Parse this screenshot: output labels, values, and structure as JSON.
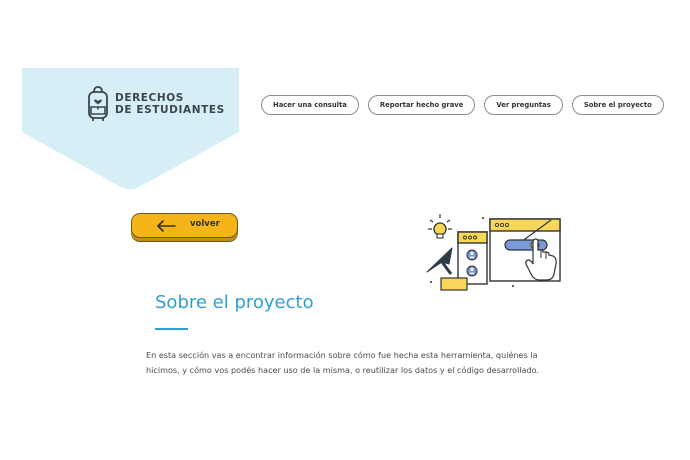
{
  "header": {
    "logo_line1": "DERECHOS",
    "logo_line2": "DE ESTUDIANTES",
    "logo_icon": "backpack-heart-icon",
    "logo_bg_color": "#d6eef6"
  },
  "nav": {
    "items": [
      {
        "label": "Hacer una consulta"
      },
      {
        "label": "Reportar hecho grave"
      },
      {
        "label": "Ver preguntas"
      },
      {
        "label": "Sobre el proyecto"
      }
    ]
  },
  "back_button": {
    "label": "volver",
    "icon": "arrow-left-icon",
    "color": "#f5b417"
  },
  "illustration": {
    "icon": "computer-interaction-illustration"
  },
  "main": {
    "title": "Sobre el proyecto",
    "title_color": "#2f9fd0",
    "body": "En esta sección vas a encontrar información sobre cómo fue hecha esta herramienta, quiénes la hicimos, y cómo vos podés hacer uso de la misma, o reutilizar los datos y el código desarrollado."
  }
}
